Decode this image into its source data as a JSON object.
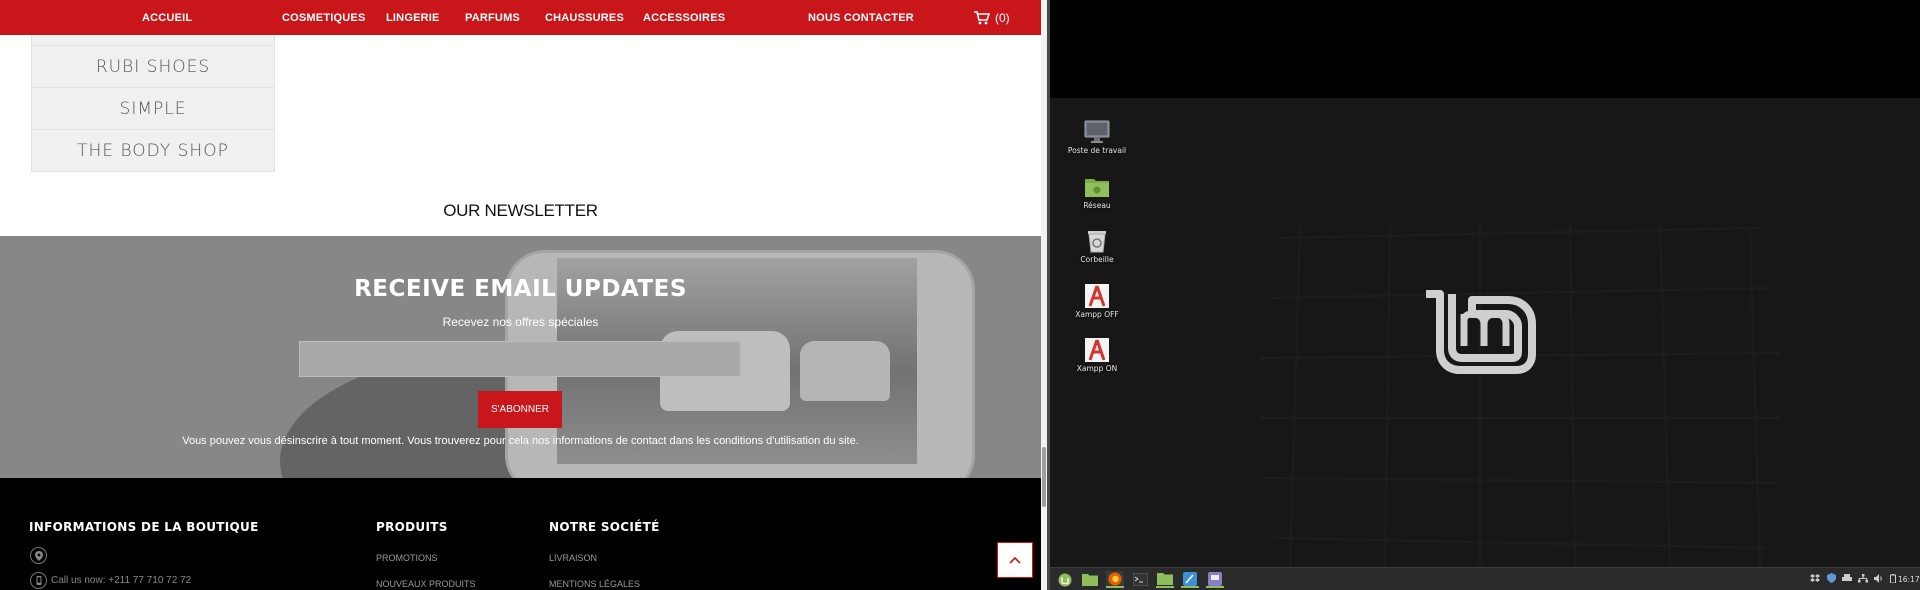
{
  "nav": {
    "items": [
      "ACCUEIL",
      "COSMETIQUES",
      "LINGERIE",
      "PARFUMS",
      "CHAUSSURES",
      "ACCESSOIRES",
      "NOUS CONTACTER"
    ],
    "cart_count": "(0)"
  },
  "brands": [
    "RUBI SHOES",
    "SIMPLE",
    "THE BODY SHOP"
  ],
  "newsletter": {
    "section_title": "OUR NEWSLETTER",
    "heading": "RECEIVE EMAIL UPDATES",
    "subheading": "Recevez nos offres spéciales",
    "email_value": "",
    "button_label": "S'ABONNER",
    "note": "Vous pouvez vous désinscrire à tout moment. Vous trouverez pour cela nos informations de contact dans les conditions d'utilisation du site."
  },
  "footer": {
    "col1_title": "INFORMATIONS DE LA BOUTIQUE",
    "phone_text": "Call us now: +211 77 710 72 72",
    "col2_title": "PRODUITS",
    "col2_links": [
      "PROMOTIONS",
      "NOUVEAUX PRODUITS"
    ],
    "col3_title": "NOTRE SOCIÉTÉ",
    "col3_links": [
      "LIVRAISON",
      "MENTIONS LÉGALES"
    ]
  },
  "desktop": {
    "icons": [
      {
        "label": "Poste de travail",
        "icon": "computer-icon"
      },
      {
        "label": "Réseau",
        "icon": "network-folder-icon"
      },
      {
        "label": "Corbeille",
        "icon": "trash-icon"
      },
      {
        "label": "Xampp OFF",
        "icon": "xampp-icon"
      },
      {
        "label": "Xampp ON",
        "icon": "xampp-icon"
      }
    ]
  },
  "taskbar": {
    "clock": "16:17"
  },
  "colors": {
    "brand_red": "#c8161b",
    "mint_green": "#8fbf5b"
  }
}
